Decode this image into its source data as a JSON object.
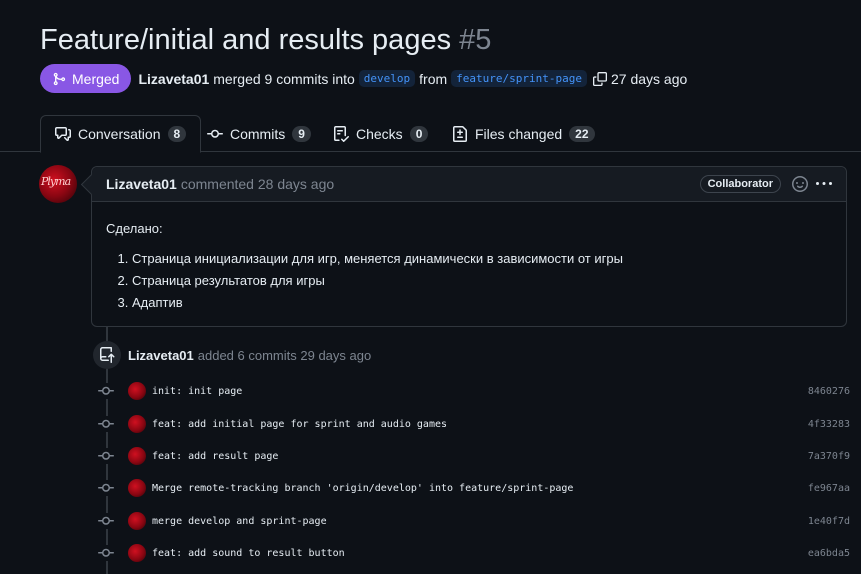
{
  "pr": {
    "title": "Feature/initial and results pages",
    "number": "#5",
    "status": "Merged",
    "author": "Lizaveta01",
    "merge_text": "merged 9 commits into",
    "base_branch": "develop",
    "from_text": "from",
    "head_branch": "feature/sprint-page",
    "time_ago": "27 days ago"
  },
  "tabs": [
    {
      "label": "Conversation",
      "count": "8",
      "icon": "comment-discussion-icon"
    },
    {
      "label": "Commits",
      "count": "9",
      "icon": "git-commit-icon"
    },
    {
      "label": "Checks",
      "count": "0",
      "icon": "checklist-icon"
    },
    {
      "label": "Files changed",
      "count": "22",
      "icon": "file-diff-icon"
    }
  ],
  "comment": {
    "author": "Lizaveta01",
    "action": "commented 28 days ago",
    "role_badge": "Collaborator",
    "avatar_text": "Plyma",
    "intro": "Сделано:",
    "items": [
      "Страница инициализации для игр, меняется динамически в зависимости от игры",
      "Страница результатов для игры",
      "Адаптив"
    ]
  },
  "event": {
    "author": "Lizaveta01",
    "text": "added 6 commits 29 days ago"
  },
  "commits": [
    {
      "message": "init: init page",
      "sha": "8460276"
    },
    {
      "message": "feat: add initial page for sprint and audio games",
      "sha": "4f33283"
    },
    {
      "message": "feat: add result page",
      "sha": "7a370f9"
    },
    {
      "message": "Merge remote-tracking branch 'origin/develop' into feature/sprint-page",
      "sha": "fe967aa"
    },
    {
      "message": "merge develop and sprint-page",
      "sha": "1e40f7d"
    },
    {
      "message": "feat: add sound to result button",
      "sha": "ea6bda5"
    }
  ],
  "colors": {
    "background": "#0d1117",
    "merged_badge": "#8957e5",
    "branch_text": "#4493f8",
    "border": "#30363d"
  }
}
